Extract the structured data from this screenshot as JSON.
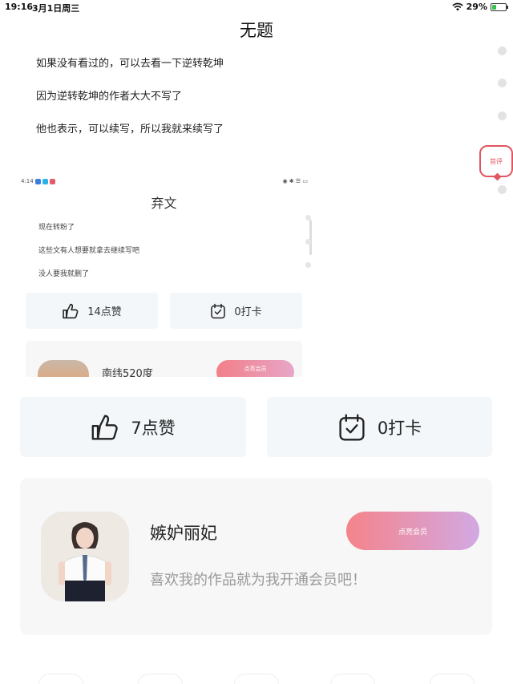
{
  "status_bar": {
    "time": "19:16",
    "date": "3月1日周三",
    "battery": "29%",
    "battery_level": 0.29
  },
  "article": {
    "title": "无题",
    "paragraphs": [
      "如果没有看过的，可以去看一下逆转乾坤",
      "因为逆转乾坤的作者大大不写了",
      "他也表示，可以续写，所以我就来续写了"
    ]
  },
  "side": {
    "comment_label": "首评"
  },
  "embedded": {
    "status_time": "4:14",
    "title": "弃文",
    "paragraphs": [
      "现在转粉了",
      "这些文有人想要就拿去继续写吧",
      "没人要我就删了"
    ],
    "like_label": "14点赞",
    "checkin_label": "0打卡",
    "author_name": "南纬520度",
    "member_button": "点亮会员"
  },
  "actions": {
    "like_label": "7点赞",
    "checkin_label": "0打卡"
  },
  "author_card": {
    "name": "嫉妒丽妃",
    "slogan": "喜欢我的作品就为我开通会员吧！",
    "member_button": "点亮会员"
  },
  "colors": {
    "accent_red": "#e05660",
    "button_bg": "#f3f7fa",
    "gradient_start": "#f5838a",
    "gradient_end": "#d2a9e3"
  }
}
